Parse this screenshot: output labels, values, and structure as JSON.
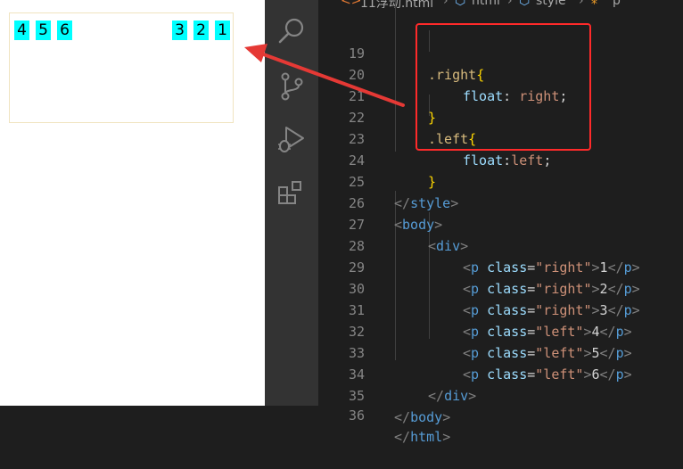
{
  "preview": {
    "left_items": [
      "4",
      "5",
      "6"
    ],
    "right_items": [
      "3",
      "2",
      "1"
    ]
  },
  "breadcrumb": {
    "file": "11浮动.html",
    "items": [
      "html",
      "style",
      "p"
    ]
  },
  "colors": {
    "float_item_bg": "#00ffff",
    "highlight_border": "#ff2a2a",
    "arrow": "#e53935"
  },
  "activity_icons": [
    "search-icon",
    "source-control-icon",
    "run-debug-icon",
    "extensions-icon"
  ],
  "code": {
    "l19": {
      "n": "19",
      "sel": ".right",
      "open": "{"
    },
    "l20": {
      "n": "20",
      "prop": "float",
      "colon": ": ",
      "val": "right",
      "semi": ";"
    },
    "l21": {
      "n": "21",
      "close": "}"
    },
    "l22": {
      "n": "22",
      "sel": ".left",
      "open": "{"
    },
    "l23": {
      "n": "23",
      "prop": "float",
      "colon": ":",
      "val": "left",
      "semi": ";"
    },
    "l24": {
      "n": "24",
      "close": "}"
    },
    "l25": {
      "n": "25",
      "lt": "</",
      "tag": "style",
      "gt": ">"
    },
    "l26": {
      "n": "26",
      "lt": "<",
      "tag": "body",
      "gt": ">"
    },
    "l27": {
      "n": "27",
      "lt": "<",
      "tag": "div",
      "gt": ">"
    },
    "l28": {
      "n": "28",
      "lt": "<",
      "tag": "p",
      "attr": "class",
      "eq": "=",
      "str": "\"right\"",
      "gt": ">",
      "text": "1",
      "clt": "</",
      "ctag": "p",
      "cgt": ">"
    },
    "l29": {
      "n": "29",
      "lt": "<",
      "tag": "p",
      "attr": "class",
      "eq": "=",
      "str": "\"right\"",
      "gt": ">",
      "text": "2",
      "clt": "</",
      "ctag": "p",
      "cgt": ">"
    },
    "l30": {
      "n": "30",
      "lt": "<",
      "tag": "p",
      "attr": "class",
      "eq": "=",
      "str": "\"right\"",
      "gt": ">",
      "text": "3",
      "clt": "</",
      "ctag": "p",
      "cgt": ">"
    },
    "l31": {
      "n": "31",
      "lt": "<",
      "tag": "p",
      "attr": "class",
      "eq": "=",
      "str": "\"left\"",
      "gt": ">",
      "text": "4",
      "clt": "</",
      "ctag": "p",
      "cgt": ">"
    },
    "l32": {
      "n": "32",
      "lt": "<",
      "tag": "p",
      "attr": "class",
      "eq": "=",
      "str": "\"left\"",
      "gt": ">",
      "text": "5",
      "clt": "</",
      "ctag": "p",
      "cgt": ">"
    },
    "l33": {
      "n": "33",
      "lt": "<",
      "tag": "p",
      "attr": "class",
      "eq": "=",
      "str": "\"left\"",
      "gt": ">",
      "text": "6",
      "clt": "</",
      "ctag": "p",
      "cgt": ">"
    },
    "l34": {
      "n": "34",
      "lt": "</",
      "tag": "div",
      "gt": ">"
    },
    "l35": {
      "n": "35",
      "lt": "</",
      "tag": "body",
      "gt": ">"
    },
    "l36": {
      "n": "36",
      "lt": "</",
      "tag": "html",
      "gt": ">"
    }
  }
}
